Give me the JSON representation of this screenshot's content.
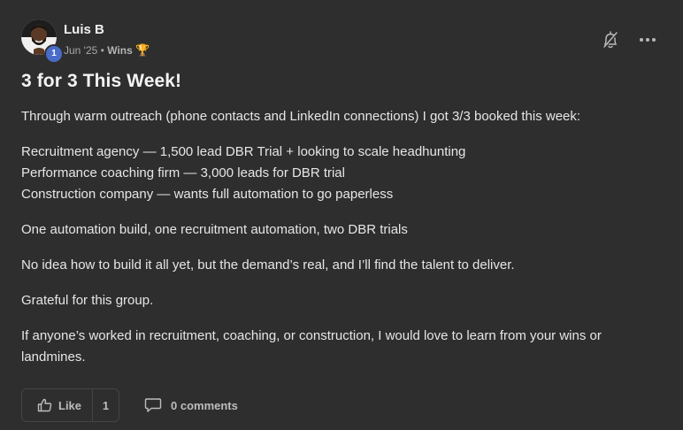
{
  "post": {
    "author": {
      "name": "Luis B",
      "level": "1",
      "avatar_icon": "user-avatar-photo"
    },
    "meta": {
      "date": "Jun '25",
      "separator": "•",
      "category": "Wins",
      "category_icon": "🏆"
    },
    "actions": {
      "bell_icon": "bell-off-icon",
      "more_icon": "more-horizontal-icon"
    },
    "title": "3 for 3 This Week!",
    "paragraphs": [
      {
        "lines": [
          "Through warm outreach (phone contacts and LinkedIn connections) I got 3/3 booked this week:"
        ]
      },
      {
        "lines": [
          "Recruitment agency — 1,500 lead DBR Trial + looking to scale headhunting",
          "Performance coaching firm — 3,000 leads for DBR trial",
          "Construction company — wants full automation to go paperless"
        ]
      },
      {
        "lines": [
          "One automation build, one recruitment automation, two DBR trials"
        ]
      },
      {
        "lines": [
          "No idea how to build it all yet, but the demand’s real, and I’ll find the talent to deliver."
        ]
      },
      {
        "lines": [
          "Grateful for this group."
        ]
      },
      {
        "lines": [
          "If anyone’s worked in recruitment, coaching, or construction, I would love to learn from your wins or landmines."
        ]
      }
    ],
    "footer": {
      "like_label": "Like",
      "like_count": "1",
      "comments_label": "0 comments"
    }
  },
  "colors": {
    "background": "#2e2e2e",
    "text": "#e6e6e6",
    "muted": "#a8a8a8",
    "badge": "#4a6cc9",
    "border": "#454545"
  }
}
